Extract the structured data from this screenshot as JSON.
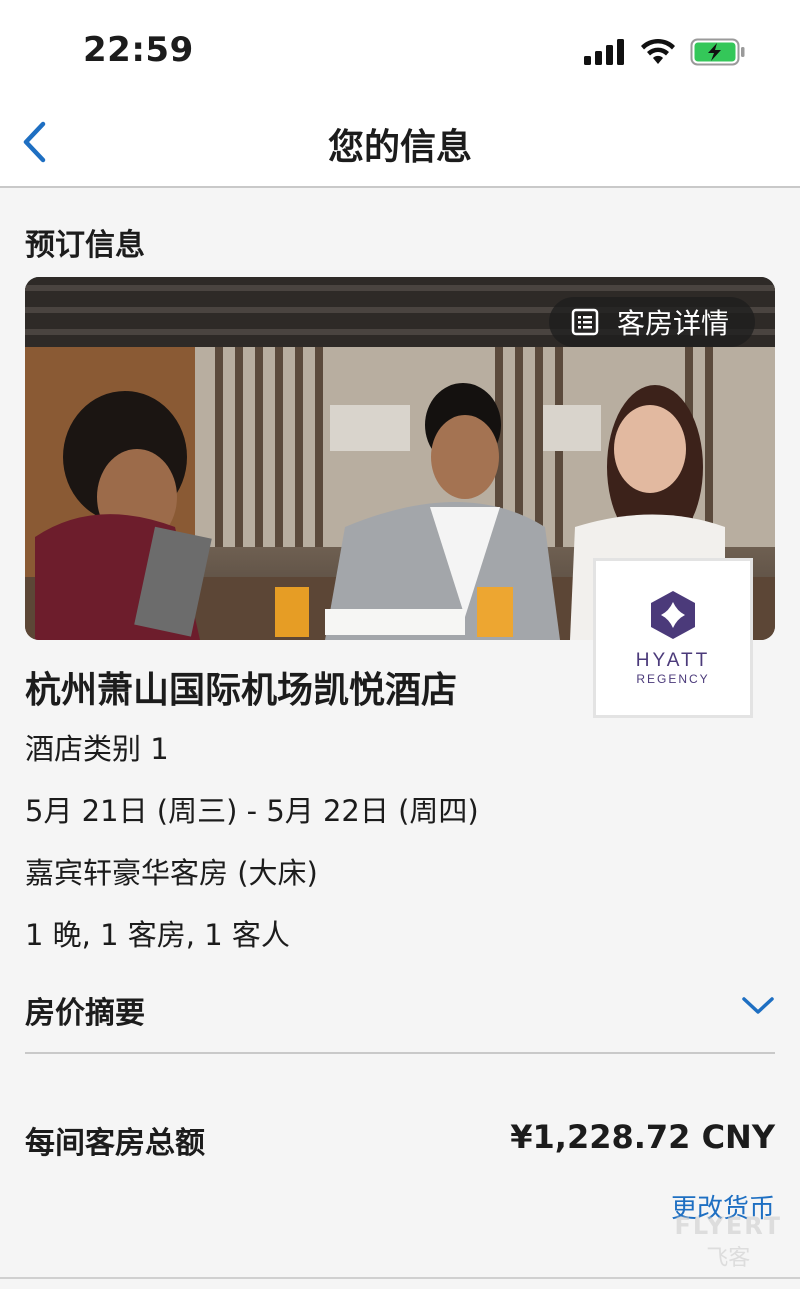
{
  "status_bar": {
    "time": "22:59"
  },
  "nav": {
    "title": "您的信息"
  },
  "booking": {
    "section_title": "预订信息",
    "room_details_label": "客房详情",
    "hotel_name": "杭州萧山国际机场凯悦酒店",
    "category": "酒店类别 1",
    "dates": "5月 21日 (周三) - 5月 22日 (周四)",
    "room_type": "嘉宾轩豪华客房 (大床)",
    "occupancy": "1 晚, 1 客房, 1 客人",
    "logo": {
      "line1": "HYATT",
      "line2": "REGENCY",
      "accent_color": "#4b3a7a"
    }
  },
  "price": {
    "summary_label": "房价摘要",
    "total_label": "每间客房总额",
    "total_value": "¥1,228.72 CNY",
    "change_currency_label": "更改货币"
  },
  "watermark": {
    "line1": "FLYERT",
    "line2": "飞客"
  },
  "colors": {
    "accent": "#1e6fc2",
    "battery_fill": "#34c759"
  }
}
